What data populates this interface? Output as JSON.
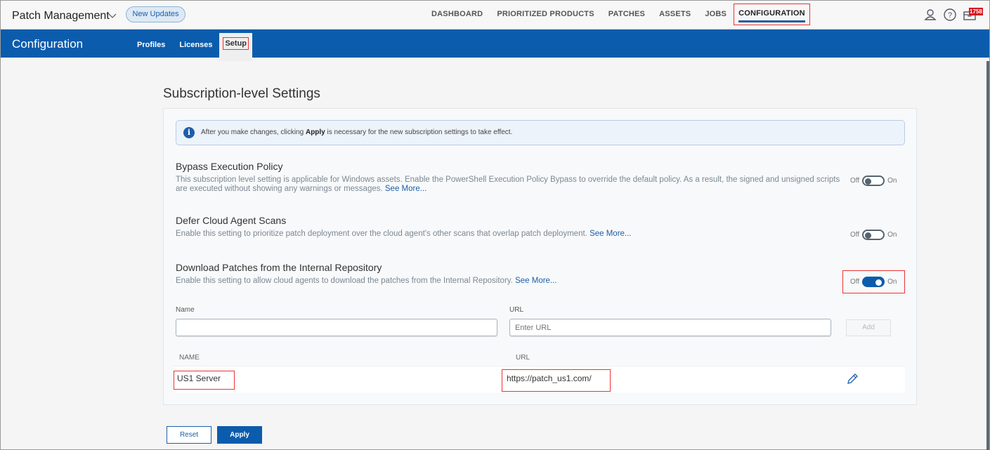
{
  "header": {
    "app_title": "Patch Management",
    "new_updates_label": "New Updates",
    "nav": [
      {
        "label": "DASHBOARD"
      },
      {
        "label": "PRIORITIZED PRODUCTS"
      },
      {
        "label": "PATCHES"
      },
      {
        "label": "ASSETS"
      },
      {
        "label": "JOBS"
      },
      {
        "label": "CONFIGURATION",
        "active": true
      }
    ],
    "icons": [
      "user-icon",
      "help-icon",
      "notifications-icon"
    ],
    "notification_count": "1758"
  },
  "subheader": {
    "title": "Configuration",
    "tabs": [
      {
        "label": "Profiles"
      },
      {
        "label": "Licenses"
      },
      {
        "label": "Setup",
        "active": true
      }
    ]
  },
  "page": {
    "heading": "Subscription-level Settings",
    "info": {
      "prefix": "After you make changes, clicking ",
      "bold": "Apply",
      "suffix": " is necessary for the new subscription settings to take effect."
    },
    "settings": [
      {
        "title": "Bypass Execution Policy",
        "description": "This subscription level setting is applicable for Windows assets. Enable the PowerShell Execution Policy Bypass to override the default policy. As a result, the signed and unsigned scripts are executed without showing any warnings or messages.",
        "see_more": "See More...",
        "toggle_off_label": "Off",
        "toggle_on_label": "On",
        "enabled": false
      },
      {
        "title": "Defer Cloud Agent Scans",
        "description": "Enable this setting to prioritize patch deployment over the cloud agent's other scans that overlap patch deployment.",
        "see_more": "See More...",
        "toggle_off_label": "Off",
        "toggle_on_label": "On",
        "enabled": false
      },
      {
        "title": "Download Patches from the Internal Repository",
        "description": "Enable this setting to allow cloud agents to download the patches from the Internal Repository.",
        "see_more": "See More...",
        "toggle_off_label": "Off",
        "toggle_on_label": "On",
        "enabled": true
      }
    ],
    "repo_form": {
      "name_label": "Name",
      "name_value": "",
      "url_label": "URL",
      "url_placeholder": "Enter URL",
      "add_label": "Add"
    },
    "repo_table": {
      "columns": [
        "NAME",
        "URL"
      ],
      "rows": [
        {
          "name": "US1 Server",
          "url": "https://patch_us1.com/"
        }
      ]
    },
    "footer": {
      "reset_label": "Reset",
      "apply_label": "Apply"
    }
  }
}
